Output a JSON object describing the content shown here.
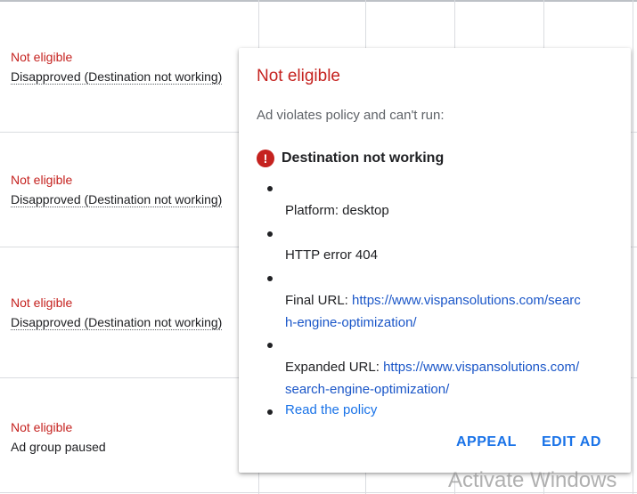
{
  "table": {
    "rows": [
      {
        "status": "Not eligible",
        "reason": "Disapproved (Destination not working)"
      },
      {
        "status": "Not eligible",
        "reason": "Disapproved (Destination not working)"
      },
      {
        "status": "Not eligible",
        "reason": "Disapproved (Destination not working)"
      },
      {
        "status": "Not eligible",
        "reason": "Ad group paused"
      }
    ]
  },
  "popup": {
    "title": "Not eligible",
    "subtitle": "Ad violates policy and can't run:",
    "issue_icon": "error-icon",
    "issue_title": "Destination not working",
    "details": {
      "platform": "Platform: desktop",
      "http_error": "HTTP error 404",
      "final_url_label": "Final URL:",
      "final_url_line1": "https://www.vispansolutions.com/searc",
      "final_url_line2": "h-engine-optimization/",
      "expanded_url_label": "Expanded URL:",
      "expanded_url_line1": "https://www.vispansolutions.com/",
      "expanded_url_line2": "search-engine-optimization/"
    },
    "policy_link": "Read the policy",
    "appeal_button": "APPEAL",
    "edit_button": "EDIT AD"
  },
  "watermark": "Activate Windows",
  "colors": {
    "error_red": "#c5221f",
    "link_blue": "#1a73e8",
    "url_blue": "#1a56c8"
  }
}
